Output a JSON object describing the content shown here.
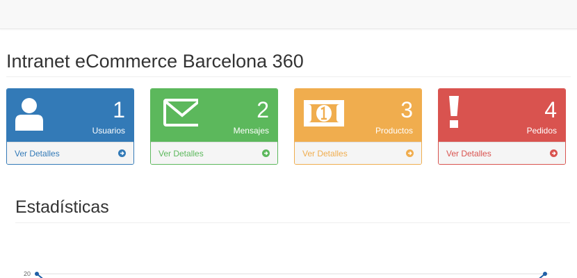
{
  "page": {
    "title": "Intranet eCommerce Barcelona 360"
  },
  "panels": [
    {
      "count": "1",
      "label": "Usuarios",
      "link": "Ver Detalles",
      "icon": "user-icon",
      "color": "#337ab7"
    },
    {
      "count": "2",
      "label": "Mensajes",
      "link": "Ver Detalles",
      "icon": "envelope-icon",
      "color": "#5cb85c"
    },
    {
      "count": "3",
      "label": "Productos",
      "link": "Ver Detalles",
      "icon": "money-icon",
      "color": "#f0ad4e"
    },
    {
      "count": "4",
      "label": "Pedidos",
      "link": "Ver Detalles",
      "icon": "exclamation-icon",
      "color": "#d9534f"
    }
  ],
  "stats": {
    "title": "Estadísticas"
  },
  "chart_data": {
    "type": "line",
    "y_tick_labels": [
      "20"
    ],
    "line_color": "#1f5fa6",
    "points": [
      {
        "x": 0,
        "y": 20
      },
      {
        "x": 1,
        "y": 20
      }
    ]
  }
}
